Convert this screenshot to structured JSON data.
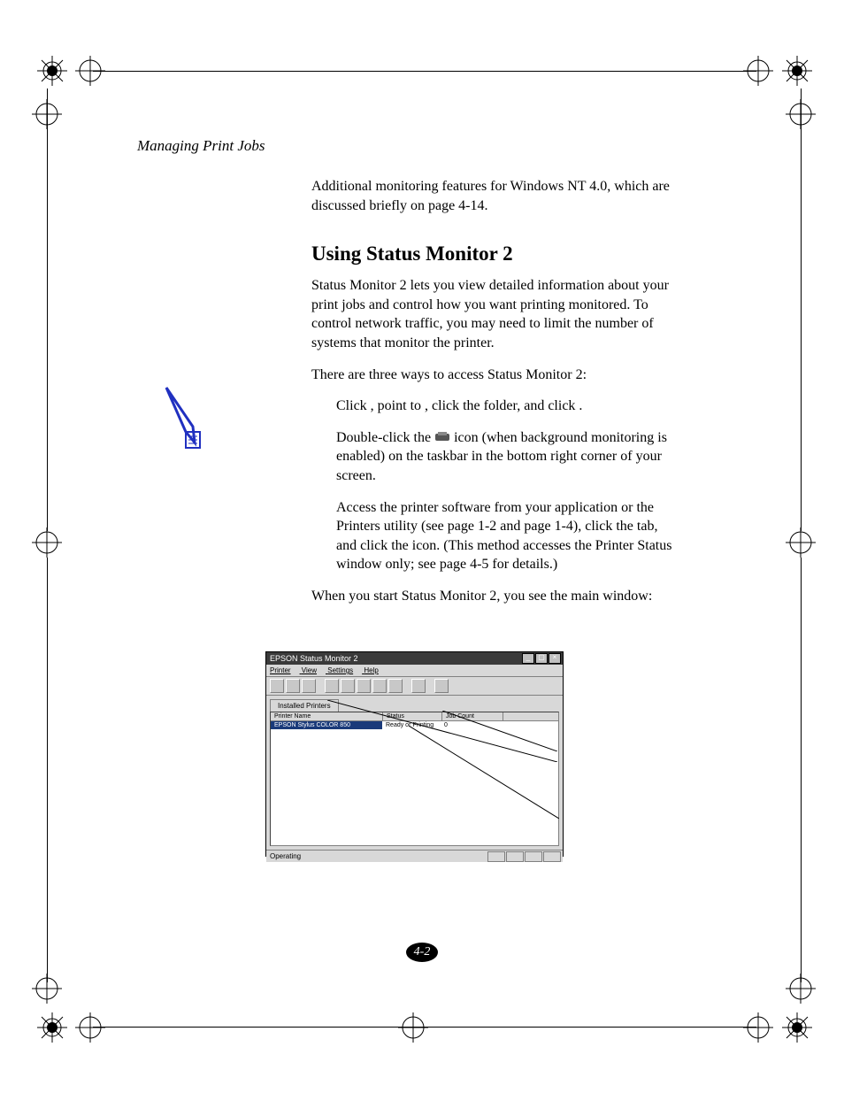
{
  "running_header": "Managing Print Jobs",
  "intro_paragraph": "Additional monitoring features for Windows NT 4.0, which are discussed briefly on page 4-14.",
  "section_heading": "Using Status Monitor 2",
  "para1": "Status Monitor 2 lets you view detailed information about your print jobs and control how you want printing monitored. To control network traffic, you may need to limit the number of systems that monitor the printer.",
  "para2": "There are three ways to access Status Monitor 2:",
  "bullet1": {
    "t1": "Click ",
    "t2": ", point to ",
    "t3": ", click the ",
    "t4": " folder, and click ",
    "t5": "."
  },
  "bullet2": {
    "t1": "Double-click the ",
    "t2": " icon (when background monitoring is enabled) on the taskbar in the bottom right corner of your screen."
  },
  "bullet3": {
    "t1": "Access the printer software from your application or the Printers utility (see page 1-2 and page 1-4), click the ",
    "t2": " tab, and click the ",
    "t3": " icon. (This method accesses the Printer Status window only; see page 4-5 for details.)"
  },
  "para3": "When you start Status Monitor 2, you see the main window:",
  "screenshot": {
    "title": "EPSON Status Monitor 2",
    "menu": [
      "Printer",
      "View",
      "Settings",
      "Help"
    ],
    "tab": "Installed Printers",
    "columns": [
      "Printer Name",
      "Status",
      "Job Count"
    ],
    "row": {
      "name": "EPSON Stylus COLOR 850",
      "status": "Ready or Printing",
      "jobs": "0"
    },
    "statusbar": "Operating"
  },
  "page_number": "4-2"
}
